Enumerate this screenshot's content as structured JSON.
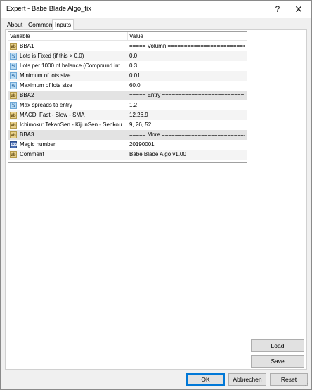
{
  "window": {
    "title": "Expert - Babe Blade Algo_fix",
    "help_glyph": "?",
    "close_glyph": "✕"
  },
  "tabs": [
    {
      "label": "About"
    },
    {
      "label": "Common"
    },
    {
      "label": "Inputs"
    }
  ],
  "grid": {
    "col_variable": "Variable",
    "col_value": "Value",
    "rows": [
      {
        "icon": "ab",
        "name": "BBA1",
        "value": "===== Volumn =========================..."
      },
      {
        "icon": "v/2",
        "name": "Lots is Fixed (if this > 0.0)",
        "value": "0.0"
      },
      {
        "icon": "v/2",
        "name": "Lots per 1000 of balance (Compound int...",
        "value": "0.3"
      },
      {
        "icon": "v/2",
        "name": "Minimum of lots size",
        "value": "0.01"
      },
      {
        "icon": "v/2",
        "name": "Maximum of lots size",
        "value": "60.0"
      },
      {
        "icon": "ab",
        "name": "BBA2",
        "value": "===== Entry ========================="
      },
      {
        "icon": "v/2",
        "name": "Max spreads to entry",
        "value": "1.2"
      },
      {
        "icon": "ab",
        "name": "MACD: Fast - Slow - SMA",
        "value": "12,26,9"
      },
      {
        "icon": "ab",
        "name": "Ichimoku: TekanSen - KijunSen - Senkou...",
        "value": "9, 26, 52"
      },
      {
        "icon": "ab",
        "name": "BBA3",
        "value": "===== More =========================="
      },
      {
        "icon": "123",
        "name": "Magic number",
        "value": "20190001"
      },
      {
        "icon": "ab",
        "name": "Comment",
        "value": "Babe Blade Algo v1.00"
      }
    ]
  },
  "side_buttons": {
    "load": "Load",
    "save": "Save"
  },
  "footer_buttons": {
    "ok": "OK",
    "cancel": "Abbrechen",
    "reset": "Reset"
  }
}
